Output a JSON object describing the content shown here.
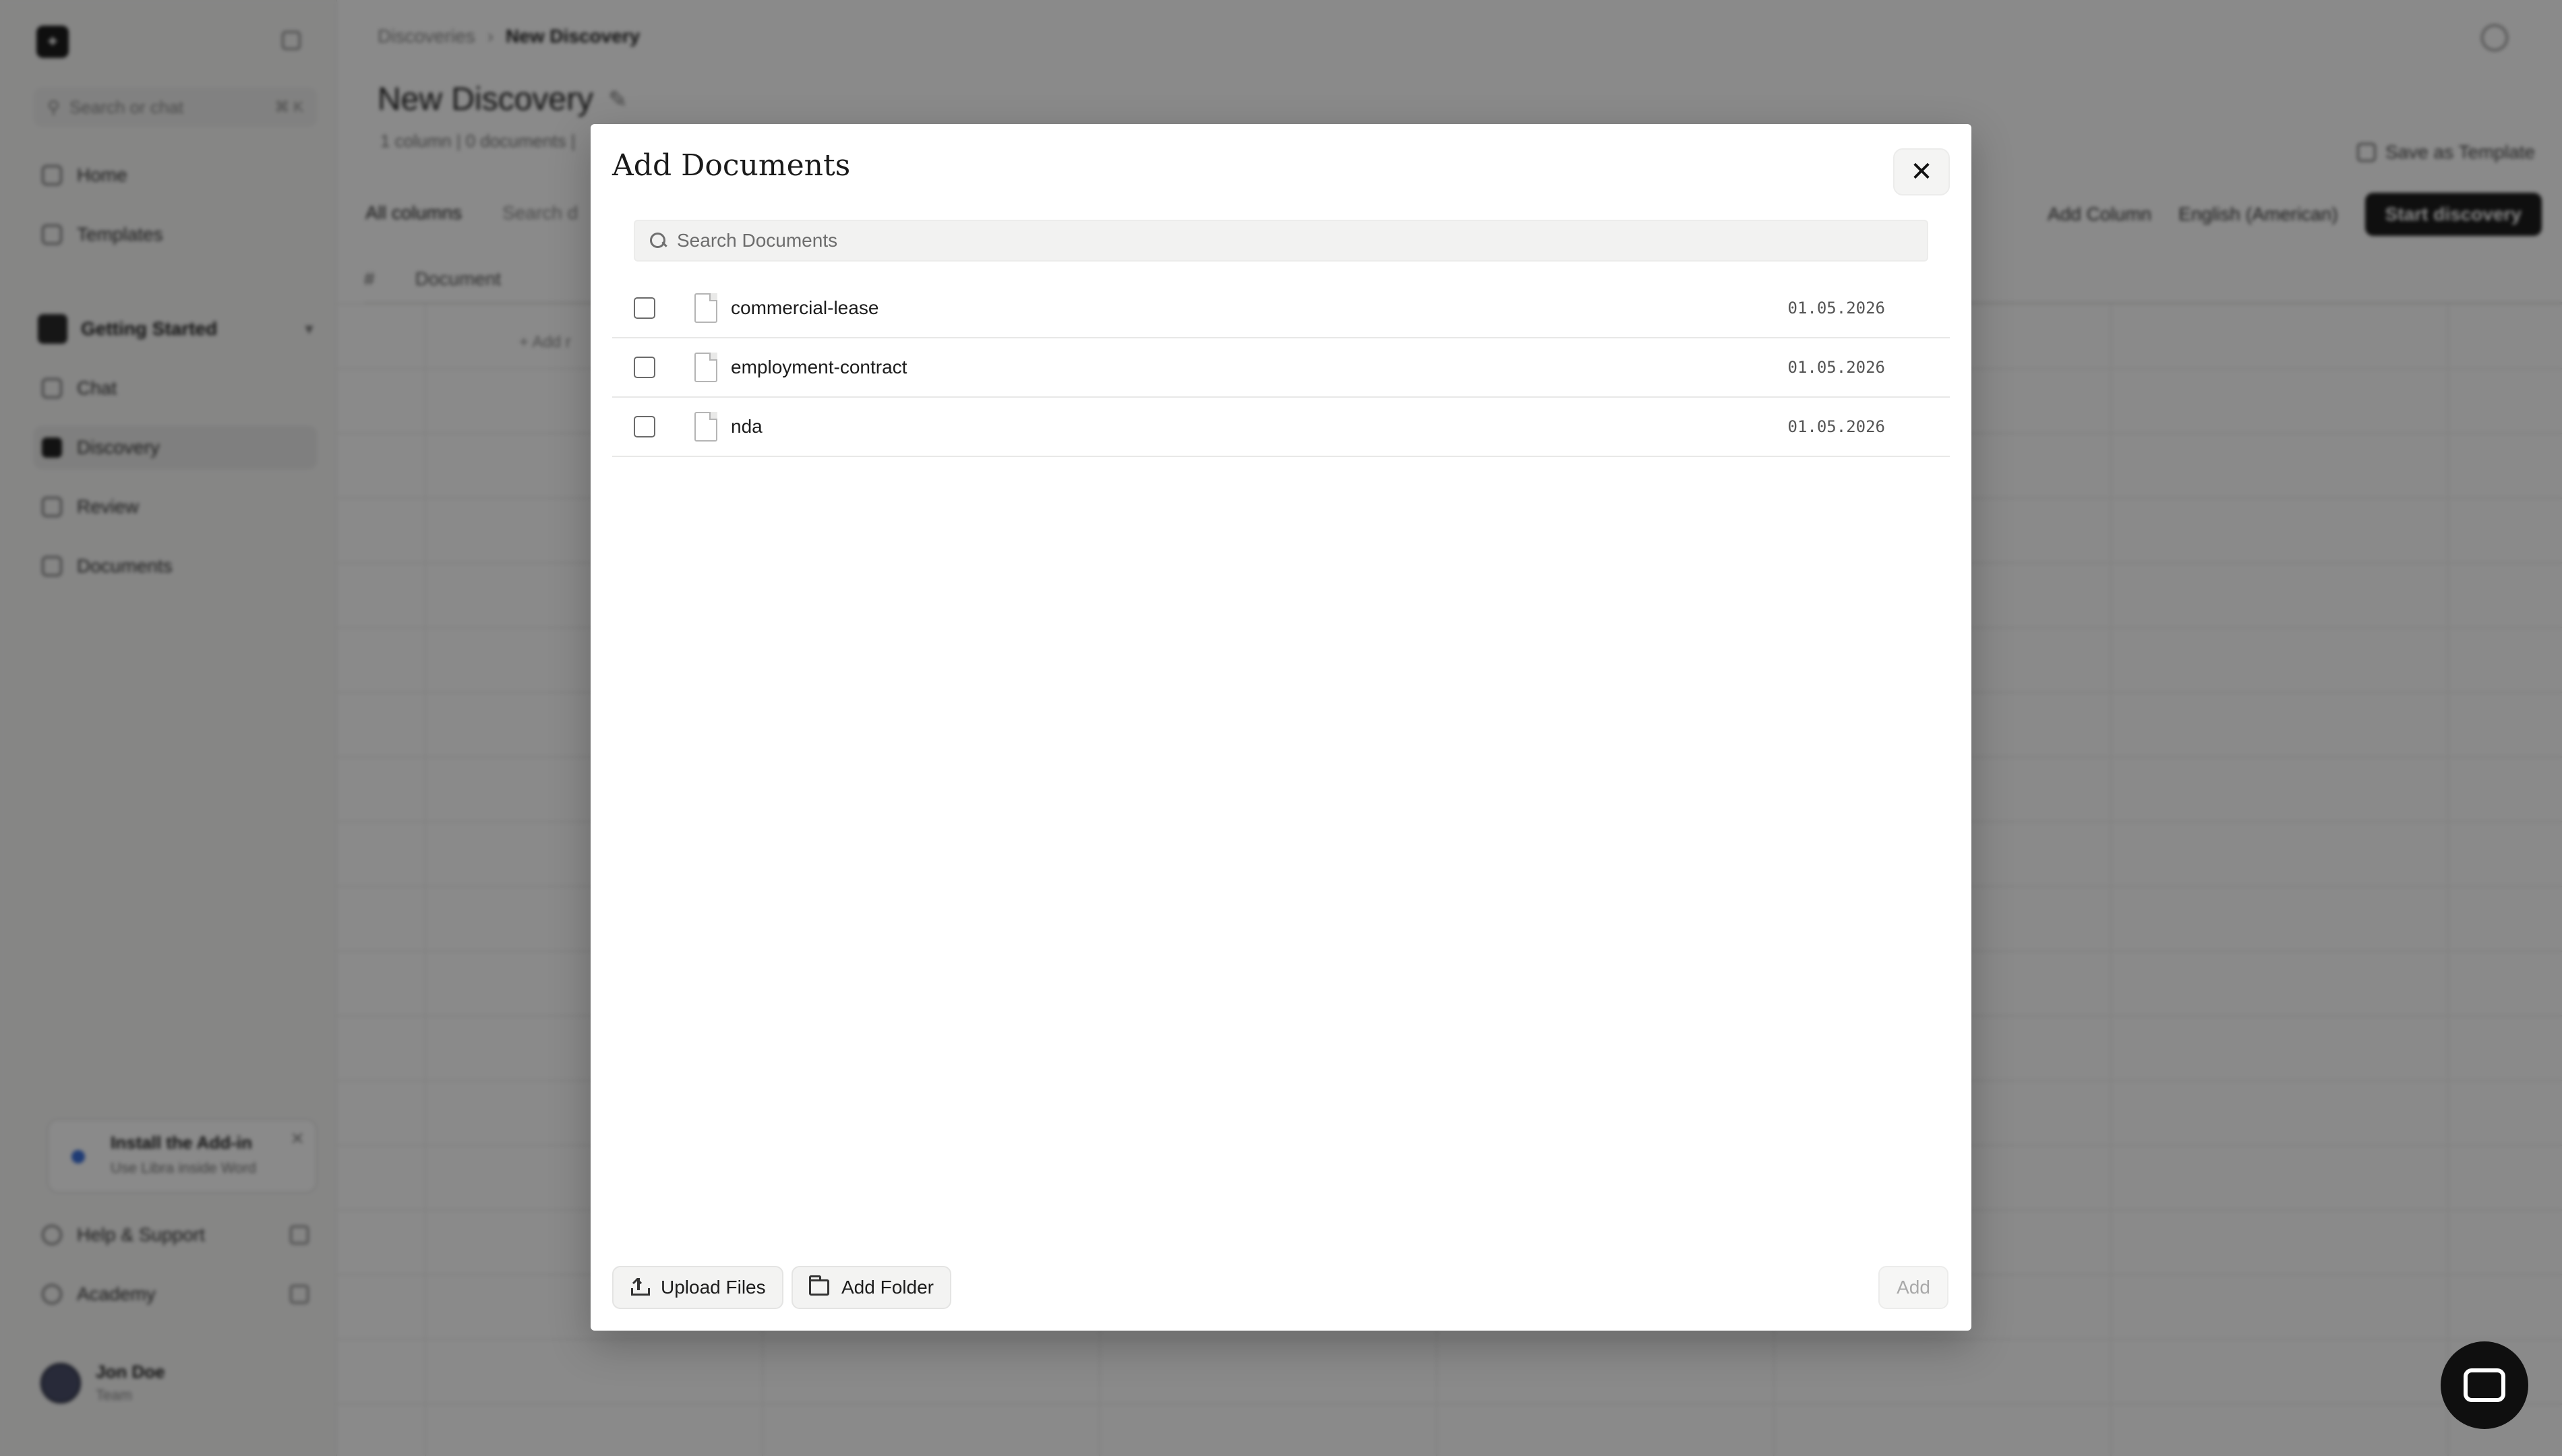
{
  "sidebar": {
    "logo": "⌖",
    "search_placeholder": "Search or chat",
    "search_shortcut": "⌘ K",
    "nav": [
      {
        "label": "Home"
      },
      {
        "label": "Templates"
      }
    ],
    "workspace": "Getting Started",
    "workspace_items": [
      {
        "label": "Chat"
      },
      {
        "label": "Discovery"
      },
      {
        "label": "Review"
      },
      {
        "label": "Documents"
      }
    ],
    "promo": {
      "title": "Install the Add-in",
      "subtitle": "Use Libra inside Word"
    },
    "links": [
      {
        "label": "Help & Support"
      },
      {
        "label": "Academy"
      }
    ],
    "user": {
      "name": "Jon Doe",
      "role": "Team"
    }
  },
  "main": {
    "breadcrumbs": [
      "Discoveries",
      "›",
      "New Discovery"
    ],
    "title": "New Discovery",
    "subtitle": "1 column | 0 documents |",
    "save_template": "Save as Template",
    "filter_columns": "All columns",
    "search_label": "Search d",
    "add_column": "Add Column",
    "language": "English (American)",
    "start_button": "Start discovery",
    "grid_headers": [
      "#",
      "Document"
    ],
    "add_row": "+ Add r"
  },
  "modal": {
    "title": "Add Documents",
    "close_icon": "✕",
    "search_placeholder": "Search Documents",
    "search_value": "",
    "documents": [
      {
        "name": "commercial-lease",
        "date": "01.05.2026"
      },
      {
        "name": "employment-contract",
        "date": "01.05.2026"
      },
      {
        "name": "nda",
        "date": "01.05.2026"
      }
    ],
    "upload_label": "Upload Files",
    "folder_label": "Add Folder",
    "add_label": "Add"
  }
}
